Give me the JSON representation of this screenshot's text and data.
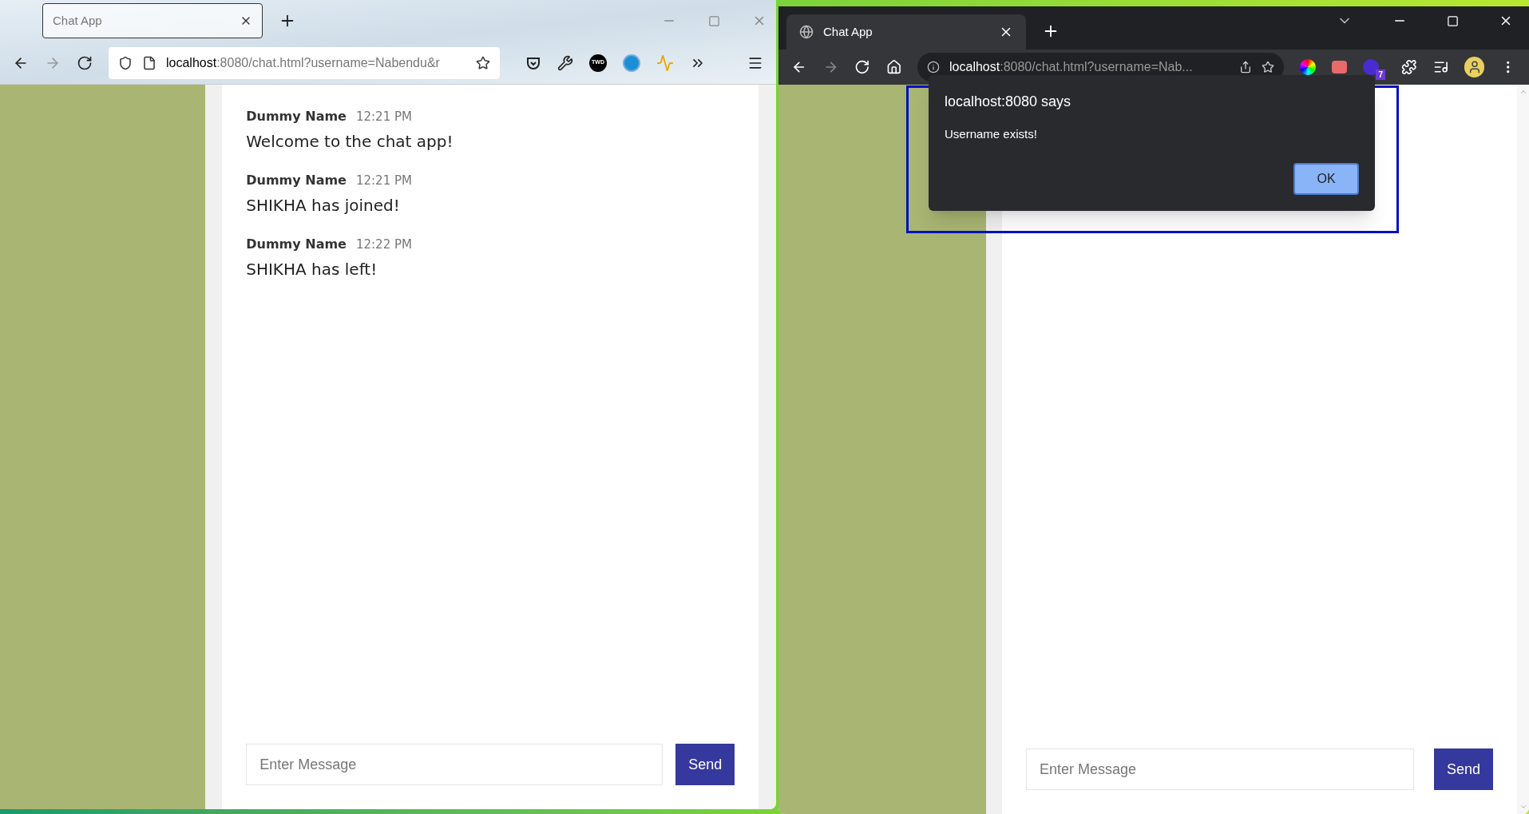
{
  "left_browser": {
    "tab_title": "Chat App",
    "url_host": "localhost",
    "url_rest": ":8080/chat.html?username=Nabendu&r",
    "extension_label": "TWD",
    "chat": {
      "messages": [
        {
          "author": "Dummy Name",
          "time": "12:21 PM",
          "text": "Welcome to the chat app!"
        },
        {
          "author": "Dummy Name",
          "time": "12:21 PM",
          "text": "SHIKHA has joined!"
        },
        {
          "author": "Dummy Name",
          "time": "12:22 PM",
          "text": "SHIKHA has left!"
        }
      ],
      "input": {
        "placeholder": "Enter Message"
      },
      "send_button": "Send"
    }
  },
  "right_browser": {
    "tab_title": "Chat App",
    "url_host": "localhost",
    "url_rest": ":8080/chat.html?username=Nab...",
    "extension_badge": "7",
    "chat": {
      "input": {
        "placeholder": "Enter Message"
      },
      "send_button": "Send"
    },
    "dialog": {
      "title": "localhost:8080 says",
      "message": "Username exists!",
      "button": "OK"
    }
  }
}
